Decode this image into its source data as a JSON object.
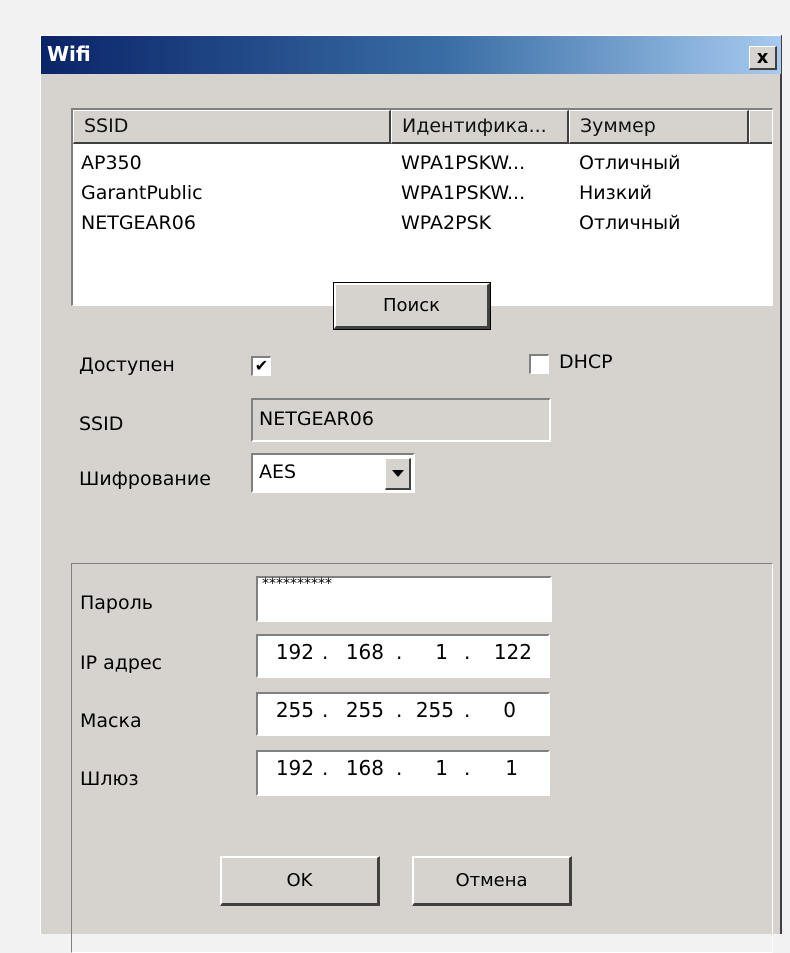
{
  "window": {
    "title": "Wifi",
    "close_label": "x"
  },
  "network_list": {
    "columns": [
      "SSID",
      "Идентифика...",
      "Зуммер"
    ],
    "rows": [
      [
        "AP350",
        "WPA1PSKW...",
        "Отличный"
      ],
      [
        "GarantPublic",
        "WPA1PSKW...",
        "Низкий"
      ],
      [
        "NETGEAR06",
        "WPA2PSK",
        "Отличный"
      ]
    ]
  },
  "search_label": "Поиск",
  "form": {
    "available_label": "Доступен",
    "available_checked": true,
    "dhcp_label": "DHCP",
    "dhcp_checked": false,
    "ssid_label": "SSID",
    "ssid_value": "NETGEAR06",
    "encryption_label": "Шифрование",
    "encryption_value": "AES"
  },
  "network_settings": {
    "password_label": "Пароль",
    "password_value": "**********",
    "ip_label": "IP адрес",
    "ip_value": [
      "192",
      "168",
      "1",
      "122"
    ],
    "mask_label": "Маска",
    "mask_value": [
      "255",
      "255",
      "255",
      "0"
    ],
    "gateway_label": "Шлюз",
    "gateway_value": [
      "192",
      "168",
      "1",
      "1"
    ]
  },
  "buttons": {
    "ok_label": "OK",
    "cancel_label": "Отмена"
  },
  "icons": {
    "check": "check-icon",
    "dropdown": "dropdown-arrow-icon"
  }
}
